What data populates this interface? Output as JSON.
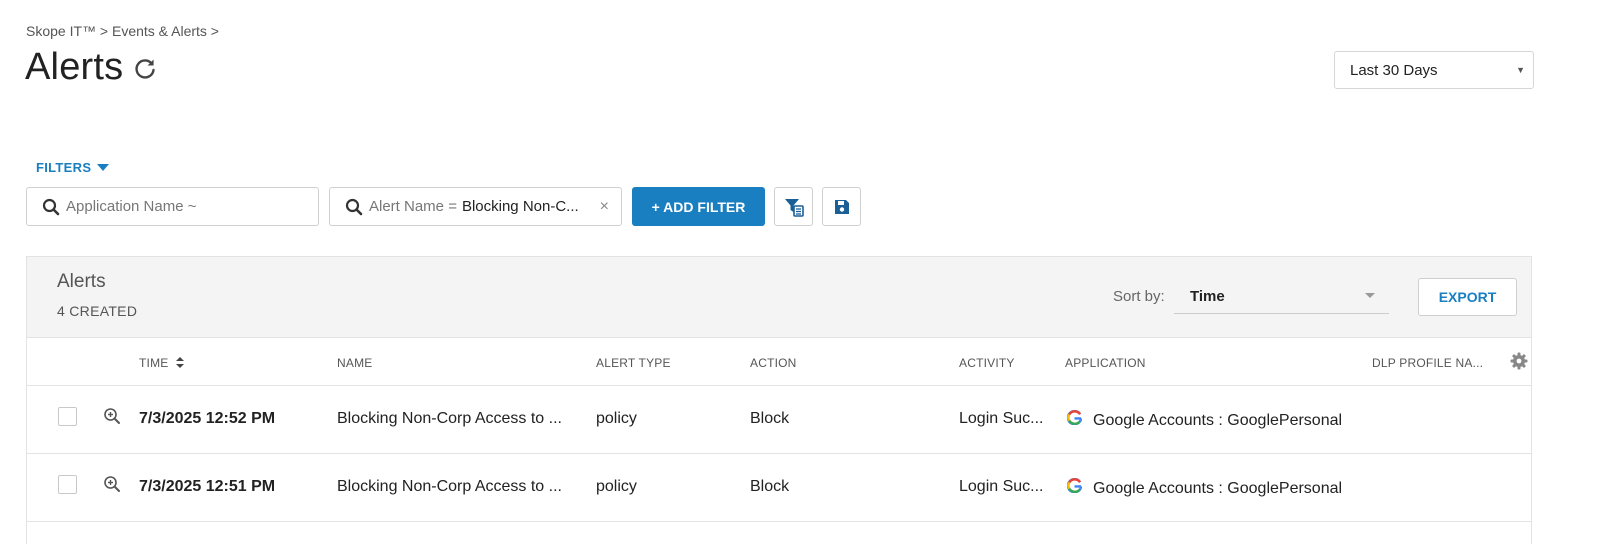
{
  "breadcrumb": "Skope IT™ > Events & Alerts >",
  "page": {
    "title": "Alerts"
  },
  "date_range": {
    "selected": "Last 30 Days"
  },
  "filters": {
    "toggle_label": "FILTERS",
    "app_filter_placeholder": "Application Name ~",
    "alert_filter_label": "Alert Name =",
    "alert_filter_value": "Blocking Non-C...",
    "add_filter_label": "+ ADD FILTER"
  },
  "panel": {
    "title": "Alerts",
    "count": "4 CREATED",
    "sort_label": "Sort by:",
    "sort_value": "Time",
    "export_label": "EXPORT"
  },
  "columns": [
    "TIME",
    "NAME",
    "ALERT TYPE",
    "ACTION",
    "ACTIVITY",
    "APPLICATION",
    "DLP PROFILE NA..."
  ],
  "rows": [
    {
      "time": "7/3/2025 12:52 PM",
      "name": "Blocking Non-Corp Access to ...",
      "alert_type": "policy",
      "action": "Block",
      "activity": "Login Suc...",
      "application": "Google Accounts : GooglePersonal"
    },
    {
      "time": "7/3/2025 12:51 PM",
      "name": "Blocking Non-Corp Access to ...",
      "alert_type": "policy",
      "action": "Block",
      "activity": "Login Suc...",
      "application": "Google Accounts : GooglePersonal"
    }
  ],
  "icons": {
    "refresh": "refresh-icon",
    "search": "search-icon",
    "clear": "close-icon",
    "filter_list": "filter-list-icon",
    "save": "save-icon",
    "sort": "sort-icon",
    "settings": "gear-icon",
    "zoom": "zoom-in-icon",
    "app_logo": "google-g-icon"
  },
  "colors": {
    "accent": "#1a7fc1",
    "panel_header": "#f4f4f4"
  }
}
